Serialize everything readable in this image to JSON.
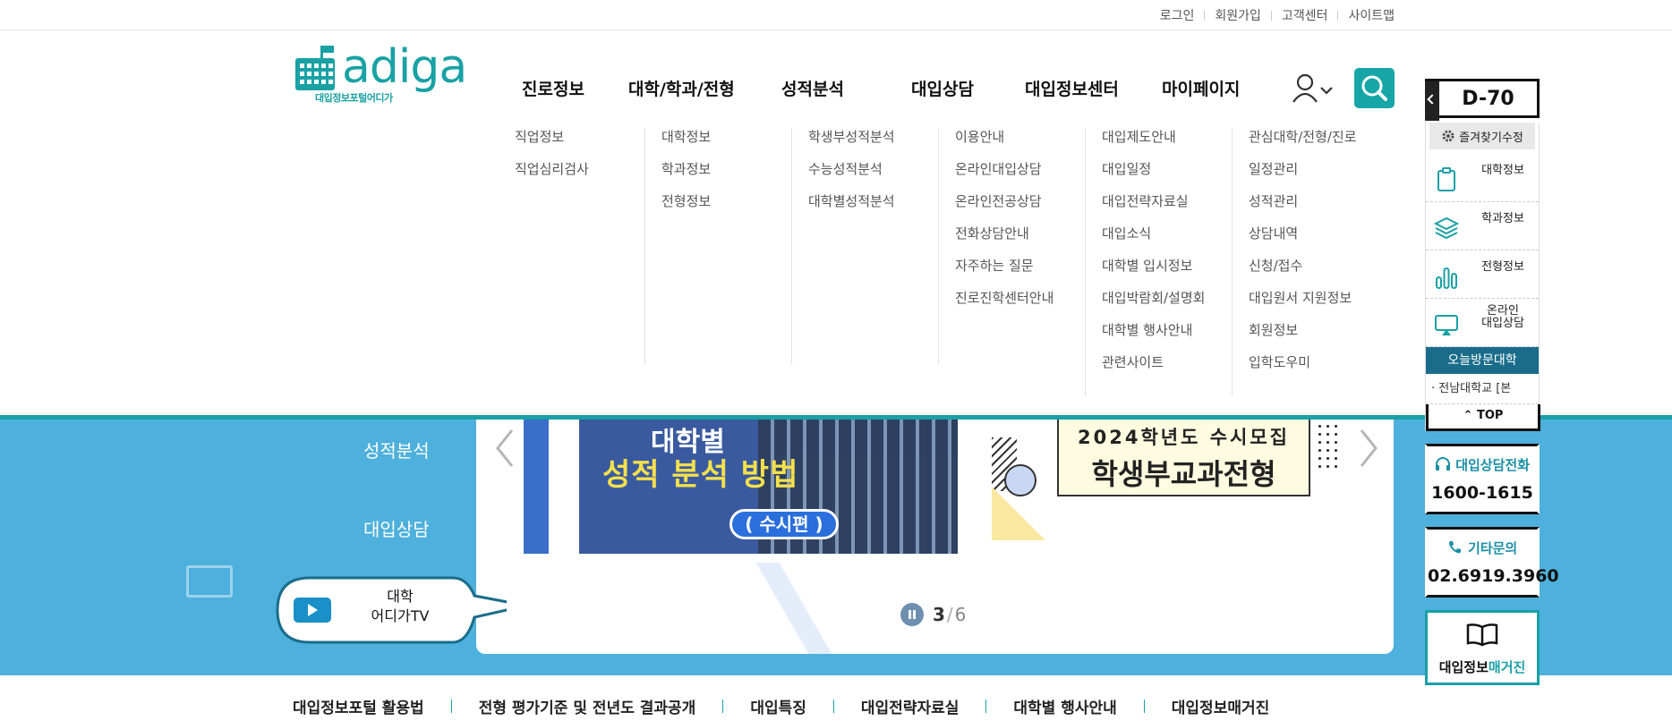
{
  "util_links": [
    "로그인",
    "회원가입",
    "고객센터",
    "사이트맵"
  ],
  "logo": {
    "text": "adiga",
    "subtitle": "대입정보포털어디가"
  },
  "gnb": [
    "진로정보",
    "대학/학과/전형",
    "성적분석",
    "대입상담",
    "대입정보센터",
    "마이페이지"
  ],
  "mega_menu": [
    {
      "items": [
        "직업정보",
        "직업심리검사"
      ]
    },
    {
      "items": [
        "대학정보",
        "학과정보",
        "전형정보"
      ]
    },
    {
      "items": [
        "학생부성적분석",
        "수능성적분석",
        "대학별성적분석"
      ]
    },
    {
      "items": [
        "이용안내",
        "온라인대입상담",
        "온라인전공상담",
        "전화상담안내",
        "자주하는 질문",
        "진로진학센터안내"
      ]
    },
    {
      "items": [
        "대입제도안내",
        "대입일정",
        "대입전략자료실",
        "대입소식",
        "대학별 입시정보",
        "대입박람회/설명회",
        "대학별 행사안내",
        "관련사이트"
      ]
    },
    {
      "items": [
        "관심대학/전형/진로",
        "일정관리",
        "성적관리",
        "상담내역",
        "신청/접수",
        "대입원서 지원정보",
        "회원정보",
        "입학도우미"
      ]
    }
  ],
  "side_menu": [
    "성적분석",
    "대입상담"
  ],
  "slides": {
    "left": {
      "title1": "대학별",
      "title2": "성적 분석 방법",
      "pill": "( 수시편 )"
    },
    "right": {
      "title1": "2024학년도 수시모집",
      "title2": "학생부교과전형"
    }
  },
  "pager": {
    "current": "3",
    "separator": "/",
    "total": "6"
  },
  "tv": {
    "line1": "대학",
    "line2": "어디가TV"
  },
  "bottom_links": [
    "대입정보포털 활용법",
    "전형 평가기준 및 전년도 결과공개",
    "대입특징",
    "대입전략자료실",
    "대학별 행사안내",
    "대입정보매거진"
  ],
  "quick": {
    "dday": "D-70",
    "fav_edit": "즐겨찾기수정",
    "items": [
      {
        "icon": "clipboard-icon",
        "label": "대학정보"
      },
      {
        "icon": "layers-icon",
        "label": "학과정보"
      },
      {
        "icon": "bar-chart-icon",
        "label": "전형정보"
      },
      {
        "icon": "monitor-icon",
        "label": "온라인\n대입상담"
      }
    ],
    "visit_title": "오늘방문대학",
    "visit_item": "· 전남대학교 [본",
    "top_label": "TOP",
    "phone": {
      "title": "대입상담전화",
      "number": "1600-1615"
    },
    "other": {
      "title": "기타문의",
      "number": "02.6919.3960"
    },
    "magazine": {
      "label_a": "대입정보",
      "label_b": "매거진"
    }
  },
  "colors": {
    "brand": "#19a1a4",
    "visual_bg": "#4eb0dc",
    "visit_title_bg": "#1a6d8a"
  }
}
